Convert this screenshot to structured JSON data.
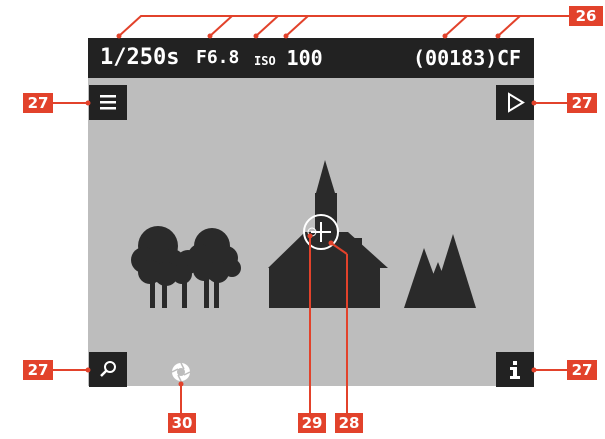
{
  "status_bar": {
    "shutter_speed": "1/250s",
    "aperture": "F6.8",
    "iso_label": "ISO",
    "iso_value": "100",
    "shots_remaining": "(00183)",
    "storage": "CF"
  },
  "callouts": {
    "status_bar": "26",
    "touch_button_menu": "27",
    "touch_button_playback": "27",
    "touch_button_zoom": "27",
    "touch_button_info": "27",
    "focus_point": "28",
    "af_field": "29",
    "shutter_icon": "30"
  },
  "colors": {
    "screen": "#bdbdbd",
    "bars": "#222222",
    "callout": "#e2422b",
    "scene": "#2a2a2a"
  },
  "icons": {
    "menu": "hamburger-icon",
    "playback": "play-icon",
    "zoom": "magnifier-icon",
    "info": "info-icon",
    "shutter": "aperture-icon"
  }
}
